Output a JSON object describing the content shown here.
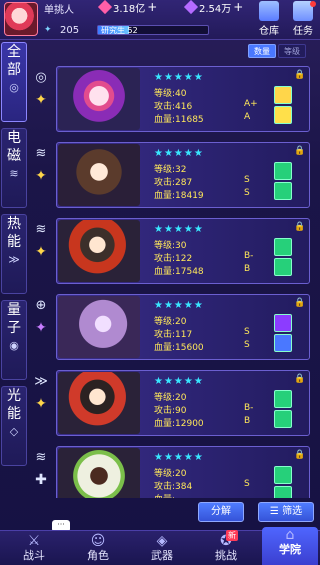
{
  "player": {
    "name": "单挑人",
    "level": "205"
  },
  "currency": [
    {
      "icon": "diamond-icon",
      "color": "#ff5fa8",
      "value": "3.18亿"
    },
    {
      "icon": "crystal-icon",
      "color": "#b56bff",
      "value": "2.54万"
    }
  ],
  "research": {
    "label": "研究生",
    "value": "52",
    "progress": 0.28
  },
  "top_buttons": [
    {
      "icon": "warehouse-icon",
      "label": "仓库"
    },
    {
      "icon": "task-icon",
      "label": "任务"
    }
  ],
  "sidebar": [
    {
      "chars": [
        "全",
        "部"
      ],
      "icon": "spiral-icon",
      "glyph": "◎"
    },
    {
      "chars": [
        "电",
        "磁"
      ],
      "icon": "wifi-icon",
      "glyph": "≋"
    },
    {
      "chars": [
        "热",
        "能"
      ],
      "icon": "flame-icon",
      "glyph": "≫"
    },
    {
      "chars": [
        "量",
        "子"
      ],
      "icon": "quantum-icon",
      "glyph": "◉"
    },
    {
      "chars": [
        "光",
        "能"
      ],
      "icon": "light-icon",
      "glyph": "◇"
    }
  ],
  "sort": [
    "数量",
    "等级"
  ],
  "characters": [
    {
      "stars": "★★★★★",
      "level": "等级:40",
      "attack": "攻击:416",
      "hp": "血量:11685",
      "atk_grade": "A+",
      "hp_grade": "A",
      "elem_glyph": "◎",
      "type_glyph": "✦",
      "type_color": "#ffd64a",
      "skill1": "#ffd64a",
      "skill2": "#ffe04a"
    },
    {
      "stars": "★★★★★",
      "level": "等级:32",
      "attack": "攻击:287",
      "hp": "血量:18419",
      "atk_grade": "S",
      "hp_grade": "S",
      "elem_glyph": "≋",
      "type_glyph": "✦",
      "type_color": "#ffd64a",
      "skill1": "#26d07a",
      "skill2": "#26d07a"
    },
    {
      "stars": "★★★★★",
      "level": "等级:30",
      "attack": "攻击:122",
      "hp": "血量:17548",
      "atk_grade": "B-",
      "hp_grade": "B",
      "elem_glyph": "≋",
      "type_glyph": "✦",
      "type_color": "#ffd64a",
      "skill1": "#26d07a",
      "skill2": "#26d07a"
    },
    {
      "stars": "★★★★★",
      "level": "等级:20",
      "attack": "攻击:117",
      "hp": "血量:15600",
      "atk_grade": "S",
      "hp_grade": "S",
      "elem_glyph": "⊕",
      "type_glyph": "✦",
      "type_color": "#c77dff",
      "skill1": "#8c3cff",
      "skill2": "#4a78ff"
    },
    {
      "stars": "★★★★★",
      "level": "等级:20",
      "attack": "攻击:90",
      "hp": "血量:12900",
      "atk_grade": "B-",
      "hp_grade": "B",
      "elem_glyph": "≫",
      "type_glyph": "✦",
      "type_color": "#ffd64a",
      "skill1": "#26d07a",
      "skill2": "#26d07a"
    },
    {
      "stars": "★★★★★",
      "level": "等级:20",
      "attack": "攻击:384",
      "hp": "血量:",
      "atk_grade": "S",
      "hp_grade": "",
      "elem_glyph": "≋",
      "type_glyph": "✚",
      "type_color": "#dfe6ff",
      "skill1": "#26d07a",
      "skill2": "#26d07a"
    }
  ],
  "actions": {
    "decompose": "分解",
    "filter": "筛选"
  },
  "chat_bubble": "···",
  "bottom_nav": [
    {
      "icon": "battle-icon",
      "glyph": "⚔",
      "label": "战斗"
    },
    {
      "icon": "role-icon",
      "glyph": "☺",
      "label": "角色"
    },
    {
      "icon": "weapon-icon",
      "glyph": "◈",
      "label": "武器"
    },
    {
      "icon": "challenge-icon",
      "glyph": "✪",
      "label": "挑战"
    },
    {
      "icon": "academy-icon",
      "glyph": "⌂",
      "label": "学院"
    }
  ],
  "new_tag": "新"
}
